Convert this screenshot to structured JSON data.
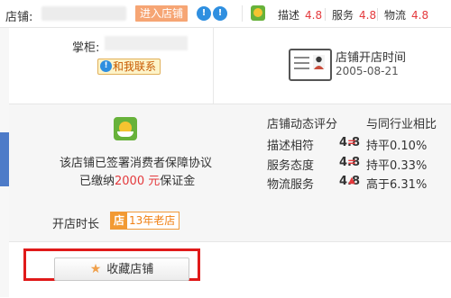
{
  "topbar": {
    "shop_label": "店铺:",
    "enter_button": "进入店铺",
    "ww_icons": [
      "wangwang-icon",
      "wangwang-icon"
    ],
    "shield_icon": "consumer-protection-shield-icon",
    "ratings": [
      {
        "label": "描述",
        "value": "4.8"
      },
      {
        "label": "服务",
        "value": "4.8"
      },
      {
        "label": "物流",
        "value": "4.8"
      }
    ]
  },
  "seller": {
    "label": "掌柜:",
    "contact_button": "和我联系"
  },
  "open_info": {
    "title": "店铺开店时间",
    "date": "2005-08-21"
  },
  "protection": {
    "line1": "该店铺已签署消费者保障协议",
    "line2_prefix": "已缴纳",
    "deposit": "2000 元",
    "line2_suffix": "保证金"
  },
  "dynamic": {
    "heading": "店铺动态评分",
    "compare_heading": "与同行业相比",
    "rows": [
      {
        "label": "描述相符",
        "score": "4.8",
        "symbol": "=",
        "compare": "持平0.10%"
      },
      {
        "label": "服务态度",
        "score": "4.8",
        "symbol": "=",
        "compare": "持平0.33%"
      },
      {
        "label": "物流服务",
        "score": "4.8",
        "symbol": "▲",
        "compare": "高于6.31%"
      }
    ]
  },
  "duration": {
    "label": "开店时长",
    "badge_icon": "店",
    "badge_text": "13年老店"
  },
  "collect": {
    "button": "收藏店铺"
  },
  "colors": {
    "accent_red": "#e4393c",
    "enter_btn_bg": "#f6a574",
    "highlight": "#e01a1a"
  }
}
